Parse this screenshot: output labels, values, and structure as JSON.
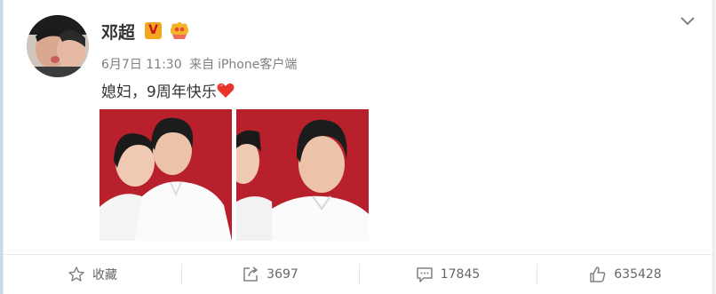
{
  "post": {
    "username": "邓超",
    "verified_badge": "V",
    "time": "6月7日 11:30",
    "source_prefix": "来自",
    "source": "iPhone客户端",
    "text": "媳妇，9周年快乐"
  },
  "actions": {
    "favorite": "收藏",
    "repost_count": "3697",
    "comment_count": "17845",
    "like_count": "635428"
  },
  "colors": {
    "accent": "#ff8200",
    "photo_background": "#b8202b"
  }
}
